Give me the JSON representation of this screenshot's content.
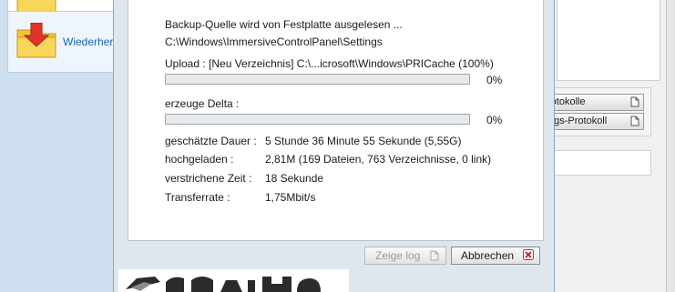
{
  "sidebar": {
    "items": [
      {
        "label": ""
      },
      {
        "label": "Wiederher"
      }
    ]
  },
  "right_panel": {
    "buttons": [
      {
        "label": "rotokolle"
      },
      {
        "label": "ngs-Protokoll"
      }
    ]
  },
  "dialog": {
    "source_text": "Backup-Quelle wird von Festplatte ausgelesen ...",
    "source_path": "C:\\Windows\\ImmersiveControlPanel\\Settings",
    "upload_line": "Upload :  [Neu Verzeichnis] C:\\...icrosoft\\Windows\\PRICache (100%)",
    "upload_progress": {
      "value": 0,
      "label": "0%"
    },
    "delta_label": "erzeuge Delta :",
    "delta_progress": {
      "value": 0,
      "label": "0%"
    },
    "stats": [
      {
        "label": "geschätzte Dauer :",
        "value": "5 Stunde 36 Minute 55 Sekunde (5,55G)"
      },
      {
        "label": "hochgeladen :",
        "value": "2,81M (169 Dateien, 763 Verzeichnisse, 0 link)"
      },
      {
        "label": "verstrichene  Zeit :",
        "value": "18 Sekunde"
      },
      {
        "label": "Transferrate :",
        "value": "1,75Mbit/s"
      }
    ],
    "buttons": {
      "show_log": {
        "label": "Zeige log",
        "enabled": false
      },
      "cancel": {
        "label": "Abbrechen"
      }
    }
  },
  "icons": {
    "sidebar_top": "folder-icon",
    "sidebar_restore": "folder-download-icon",
    "protocol_docs": "document-icon",
    "show_log": "document-icon",
    "cancel": "close-icon",
    "brand_logo": "logo"
  },
  "colors": {
    "accent_link": "#1a66b8",
    "cancel_icon": "#d62828",
    "progress": "#3da83d"
  }
}
